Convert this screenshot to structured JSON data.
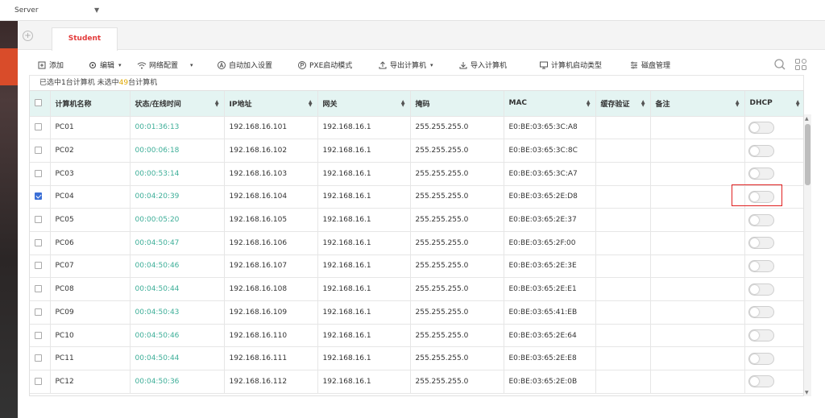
{
  "header": {
    "server_label": "Server",
    "caret": "▼"
  },
  "tabs": {
    "add": "+",
    "active": "Student"
  },
  "toolbar": {
    "add": "添加",
    "edit": "编辑",
    "network": "网络配置",
    "auto_join": "自动加入设置",
    "pxe": "PXE启动模式",
    "export": "导出计算机",
    "import": "导入计算机",
    "boot_type": "计算机启动类型",
    "disk": "磁盘管理",
    "caret": "▾"
  },
  "selection": {
    "prefix": "已选中",
    "selected": "1",
    "mid": "台计算机  未选中",
    "unselected": "49",
    "suffix": "台计算机"
  },
  "columns": [
    "计算机名称",
    "状态/在线时间",
    "IP地址",
    "网关",
    "掩码",
    "MAC",
    "缓存验证",
    "备注",
    "DHCP"
  ],
  "rows": [
    {
      "name": "PC01",
      "time": "00:01:36:13",
      "ip": "192.168.16.101",
      "gw": "192.168.16.1",
      "mask": "255.255.255.0",
      "mac": "E0:BE:03:65:3C:A8",
      "checked": false
    },
    {
      "name": "PC02",
      "time": "00:00:06:18",
      "ip": "192.168.16.102",
      "gw": "192.168.16.1",
      "mask": "255.255.255.0",
      "mac": "E0:BE:03:65:3C:8C",
      "checked": false
    },
    {
      "name": "PC03",
      "time": "00:00:53:14",
      "ip": "192.168.16.103",
      "gw": "192.168.16.1",
      "mask": "255.255.255.0",
      "mac": "E0:BE:03:65:3C:A7",
      "checked": false
    },
    {
      "name": "PC04",
      "time": "00:04:20:39",
      "ip": "192.168.16.104",
      "gw": "192.168.16.1",
      "mask": "255.255.255.0",
      "mac": "E0:BE:03:65:2E:D8",
      "checked": true
    },
    {
      "name": "PC05",
      "time": "00:00:05:20",
      "ip": "192.168.16.105",
      "gw": "192.168.16.1",
      "mask": "255.255.255.0",
      "mac": "E0:BE:03:65:2E:37",
      "checked": false
    },
    {
      "name": "PC06",
      "time": "00:04:50:47",
      "ip": "192.168.16.106",
      "gw": "192.168.16.1",
      "mask": "255.255.255.0",
      "mac": "E0:BE:03:65:2F:00",
      "checked": false
    },
    {
      "name": "PC07",
      "time": "00:04:50:46",
      "ip": "192.168.16.107",
      "gw": "192.168.16.1",
      "mask": "255.255.255.0",
      "mac": "E0:BE:03:65:2E:3E",
      "checked": false
    },
    {
      "name": "PC08",
      "time": "00:04:50:44",
      "ip": "192.168.16.108",
      "gw": "192.168.16.1",
      "mask": "255.255.255.0",
      "mac": "E0:BE:03:65:2E:E1",
      "checked": false
    },
    {
      "name": "PC09",
      "time": "00:04:50:43",
      "ip": "192.168.16.109",
      "gw": "192.168.16.1",
      "mask": "255.255.255.0",
      "mac": "E0:BE:03:65:41:EB",
      "checked": false
    },
    {
      "name": "PC10",
      "time": "00:04:50:46",
      "ip": "192.168.16.110",
      "gw": "192.168.16.1",
      "mask": "255.255.255.0",
      "mac": "E0:BE:03:65:2E:64",
      "checked": false
    },
    {
      "name": "PC11",
      "time": "00:04:50:44",
      "ip": "192.168.16.111",
      "gw": "192.168.16.1",
      "mask": "255.255.255.0",
      "mac": "E0:BE:03:65:2E:E8",
      "checked": false
    },
    {
      "name": "PC12",
      "time": "00:04:50:36",
      "ip": "192.168.16.112",
      "gw": "192.168.16.1",
      "mask": "255.255.255.0",
      "mac": "E0:BE:03:65:2E:0B",
      "checked": false
    }
  ],
  "colors": {
    "accent": "#e33b3b",
    "time": "#3dae98",
    "header_bg": "#e4f4f2",
    "checkbox": "#3b6fd6",
    "highlight": "#e02020"
  }
}
